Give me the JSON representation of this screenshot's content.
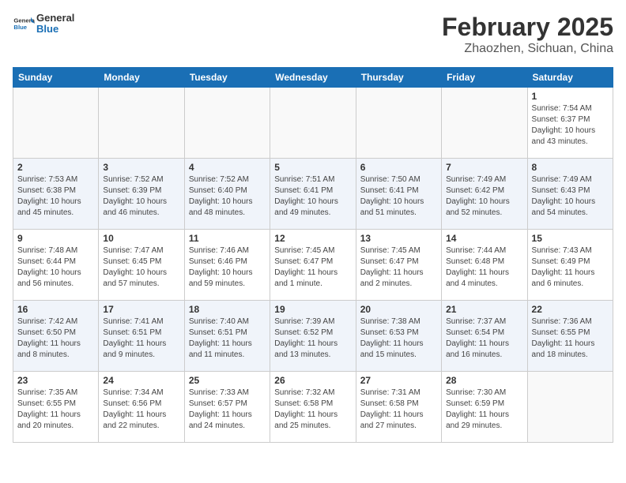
{
  "header": {
    "logo_general": "General",
    "logo_blue": "Blue",
    "month": "February 2025",
    "location": "Zhaozhen, Sichuan, China"
  },
  "weekdays": [
    "Sunday",
    "Monday",
    "Tuesday",
    "Wednesday",
    "Thursday",
    "Friday",
    "Saturday"
  ],
  "weeks": [
    [
      {
        "day": "",
        "info": ""
      },
      {
        "day": "",
        "info": ""
      },
      {
        "day": "",
        "info": ""
      },
      {
        "day": "",
        "info": ""
      },
      {
        "day": "",
        "info": ""
      },
      {
        "day": "",
        "info": ""
      },
      {
        "day": "1",
        "info": "Sunrise: 7:54 AM\nSunset: 6:37 PM\nDaylight: 10 hours and 43 minutes."
      }
    ],
    [
      {
        "day": "2",
        "info": "Sunrise: 7:53 AM\nSunset: 6:38 PM\nDaylight: 10 hours and 45 minutes."
      },
      {
        "day": "3",
        "info": "Sunrise: 7:52 AM\nSunset: 6:39 PM\nDaylight: 10 hours and 46 minutes."
      },
      {
        "day": "4",
        "info": "Sunrise: 7:52 AM\nSunset: 6:40 PM\nDaylight: 10 hours and 48 minutes."
      },
      {
        "day": "5",
        "info": "Sunrise: 7:51 AM\nSunset: 6:41 PM\nDaylight: 10 hours and 49 minutes."
      },
      {
        "day": "6",
        "info": "Sunrise: 7:50 AM\nSunset: 6:41 PM\nDaylight: 10 hours and 51 minutes."
      },
      {
        "day": "7",
        "info": "Sunrise: 7:49 AM\nSunset: 6:42 PM\nDaylight: 10 hours and 52 minutes."
      },
      {
        "day": "8",
        "info": "Sunrise: 7:49 AM\nSunset: 6:43 PM\nDaylight: 10 hours and 54 minutes."
      }
    ],
    [
      {
        "day": "9",
        "info": "Sunrise: 7:48 AM\nSunset: 6:44 PM\nDaylight: 10 hours and 56 minutes."
      },
      {
        "day": "10",
        "info": "Sunrise: 7:47 AM\nSunset: 6:45 PM\nDaylight: 10 hours and 57 minutes."
      },
      {
        "day": "11",
        "info": "Sunrise: 7:46 AM\nSunset: 6:46 PM\nDaylight: 10 hours and 59 minutes."
      },
      {
        "day": "12",
        "info": "Sunrise: 7:45 AM\nSunset: 6:47 PM\nDaylight: 11 hours and 1 minute."
      },
      {
        "day": "13",
        "info": "Sunrise: 7:45 AM\nSunset: 6:47 PM\nDaylight: 11 hours and 2 minutes."
      },
      {
        "day": "14",
        "info": "Sunrise: 7:44 AM\nSunset: 6:48 PM\nDaylight: 11 hours and 4 minutes."
      },
      {
        "day": "15",
        "info": "Sunrise: 7:43 AM\nSunset: 6:49 PM\nDaylight: 11 hours and 6 minutes."
      }
    ],
    [
      {
        "day": "16",
        "info": "Sunrise: 7:42 AM\nSunset: 6:50 PM\nDaylight: 11 hours and 8 minutes."
      },
      {
        "day": "17",
        "info": "Sunrise: 7:41 AM\nSunset: 6:51 PM\nDaylight: 11 hours and 9 minutes."
      },
      {
        "day": "18",
        "info": "Sunrise: 7:40 AM\nSunset: 6:51 PM\nDaylight: 11 hours and 11 minutes."
      },
      {
        "day": "19",
        "info": "Sunrise: 7:39 AM\nSunset: 6:52 PM\nDaylight: 11 hours and 13 minutes."
      },
      {
        "day": "20",
        "info": "Sunrise: 7:38 AM\nSunset: 6:53 PM\nDaylight: 11 hours and 15 minutes."
      },
      {
        "day": "21",
        "info": "Sunrise: 7:37 AM\nSunset: 6:54 PM\nDaylight: 11 hours and 16 minutes."
      },
      {
        "day": "22",
        "info": "Sunrise: 7:36 AM\nSunset: 6:55 PM\nDaylight: 11 hours and 18 minutes."
      }
    ],
    [
      {
        "day": "23",
        "info": "Sunrise: 7:35 AM\nSunset: 6:55 PM\nDaylight: 11 hours and 20 minutes."
      },
      {
        "day": "24",
        "info": "Sunrise: 7:34 AM\nSunset: 6:56 PM\nDaylight: 11 hours and 22 minutes."
      },
      {
        "day": "25",
        "info": "Sunrise: 7:33 AM\nSunset: 6:57 PM\nDaylight: 11 hours and 24 minutes."
      },
      {
        "day": "26",
        "info": "Sunrise: 7:32 AM\nSunset: 6:58 PM\nDaylight: 11 hours and 25 minutes."
      },
      {
        "day": "27",
        "info": "Sunrise: 7:31 AM\nSunset: 6:58 PM\nDaylight: 11 hours and 27 minutes."
      },
      {
        "day": "28",
        "info": "Sunrise: 7:30 AM\nSunset: 6:59 PM\nDaylight: 11 hours and 29 minutes."
      },
      {
        "day": "",
        "info": ""
      }
    ]
  ]
}
